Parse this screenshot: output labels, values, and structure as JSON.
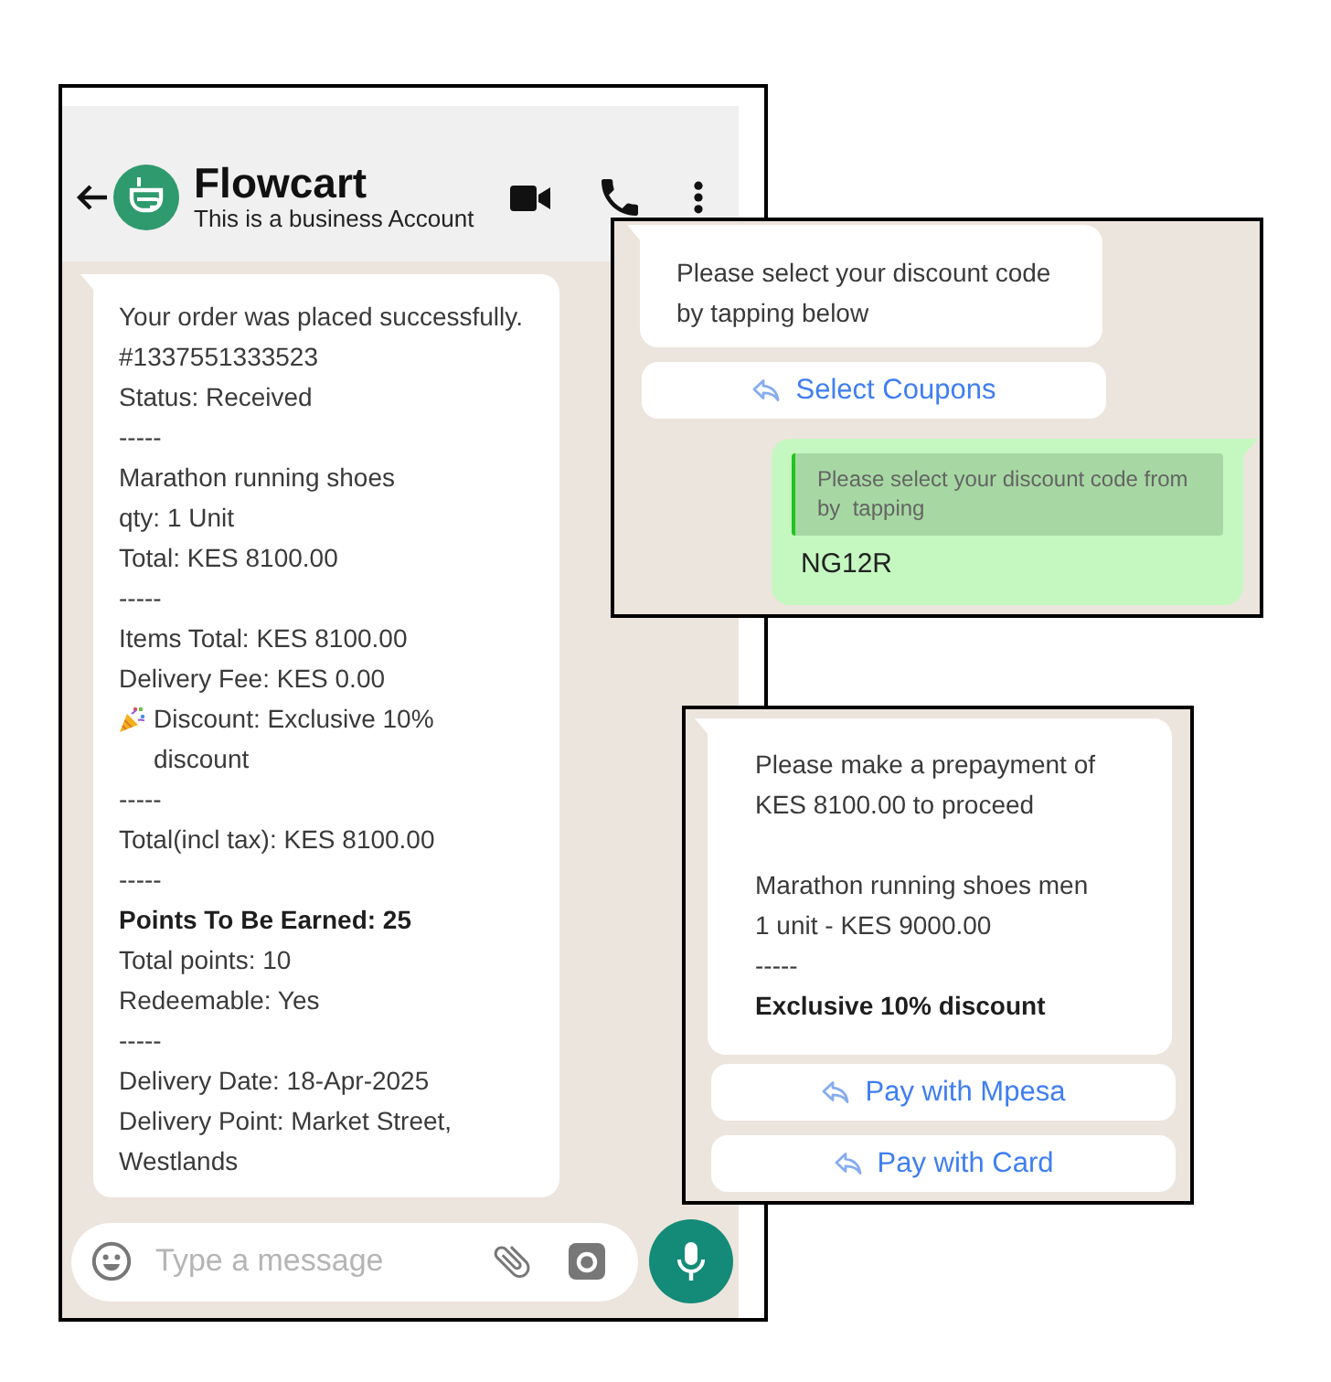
{
  "chat_header": {
    "title": "Flowcart",
    "subtitle": "This is a business Account"
  },
  "order_message": {
    "lines": [
      {
        "kind": "plain",
        "text": "Your order was placed successfully."
      },
      {
        "kind": "plain",
        "text": "#1337551333523"
      },
      {
        "kind": "plain",
        "text": "Status: Received"
      },
      {
        "kind": "plain",
        "text": "-----"
      },
      {
        "kind": "plain",
        "text": "Marathon running shoes"
      },
      {
        "kind": "plain",
        "text": "qty: 1 Unit"
      },
      {
        "kind": "plain",
        "text": "Total: KES 8100.00"
      },
      {
        "kind": "plain",
        "text": "-----"
      },
      {
        "kind": "plain",
        "text": "Items Total: KES 8100.00"
      },
      {
        "kind": "plain",
        "text": "Delivery Fee: KES 0.00"
      },
      {
        "kind": "party",
        "text": "Discount: Exclusive 10% discount"
      },
      {
        "kind": "plain",
        "text": "-----"
      },
      {
        "kind": "plain",
        "text": "Total(incl tax): KES 8100.00"
      },
      {
        "kind": "plain",
        "text": "-----"
      },
      {
        "kind": "bold",
        "text": "Points To Be Earned: 25"
      },
      {
        "kind": "plain",
        "text": "Total points: 10"
      },
      {
        "kind": "plain",
        "text": "Redeemable: Yes"
      },
      {
        "kind": "plain",
        "text": "-----"
      },
      {
        "kind": "plain",
        "text": "Delivery Date: 18-Apr-2025"
      },
      {
        "kind": "plain",
        "text": "Delivery Point: Market Street, Westlands"
      }
    ]
  },
  "composer": {
    "placeholder": "Type a message"
  },
  "coupon_chat": {
    "message": "Please select your discount code by tapping below",
    "buttons": [
      {
        "label": "Select Coupons"
      }
    ],
    "reply": {
      "quoted": "Please select your discount code from by  tapping",
      "text": "NG12R"
    }
  },
  "payment_chat": {
    "paragraphs": [
      {
        "lines": [
          {
            "kind": "plain",
            "text": "Please make a prepayment of KES 8100.00 to proceed"
          }
        ]
      },
      {
        "lines": [
          {
            "kind": "plain",
            "text": "Marathon running shoes men"
          },
          {
            "kind": "plain",
            "text": "1 unit - KES 9000.00"
          },
          {
            "kind": "plain",
            "text": "-----"
          },
          {
            "kind": "bold",
            "text": "Exclusive 10% discount"
          }
        ]
      }
    ],
    "buttons": [
      {
        "label": "Pay with Mpesa"
      },
      {
        "label": "Pay with Card"
      }
    ]
  }
}
